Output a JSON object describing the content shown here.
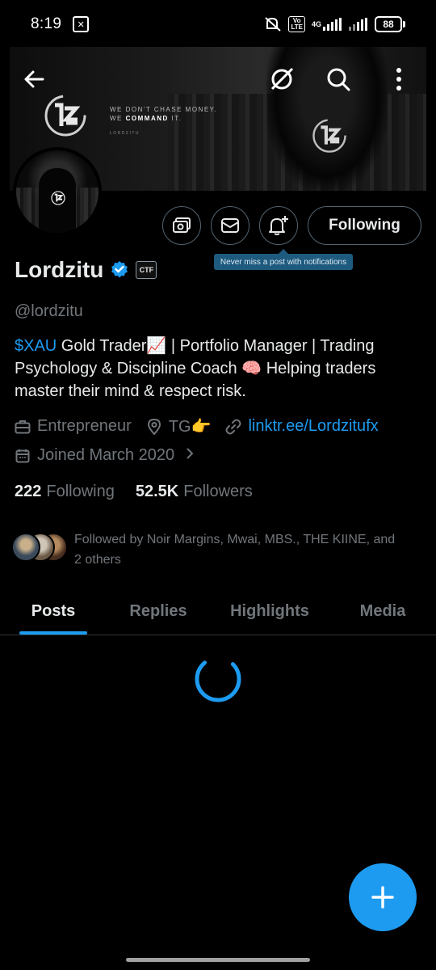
{
  "status_bar": {
    "time": "8:19",
    "signal_label": "4G",
    "volte_label": "Vo\nLTE",
    "battery": "88"
  },
  "banner": {
    "tagline_line1": "WE DON'T CHASE MONEY.",
    "tagline_line2_prefix": "WE ",
    "tagline_line2_bold": "COMMAND",
    "tagline_line2_suffix": " IT.",
    "sub": "LORDZITU"
  },
  "profile": {
    "name": "Lordzitu",
    "handle": "@lordzitu",
    "bio_cashtag": "$XAU",
    "bio_rest": " Gold Trader📈 | Portfolio Manager | Trading Psychology & Discipline Coach 🧠 Helping traders master their mind & respect risk.",
    "category": "Entrepreneur",
    "location": "TG👉",
    "link": "linktr.ee/Lordzitufx",
    "joined": "Joined March 2020",
    "following_count": "222",
    "following_label": "Following",
    "followers_count": "52.5K",
    "followers_label": "Followers",
    "followed_by": "Followed by Noir Margins, Mwai, MBS., THE KIINE, and 2 others",
    "affiliate_badge": "CTF"
  },
  "actions": {
    "following_button": "Following",
    "tooltip": "Never miss a post with notifications"
  },
  "tabs": [
    {
      "label": "Posts",
      "active": true
    },
    {
      "label": "Replies",
      "active": false
    },
    {
      "label": "Highlights",
      "active": false
    },
    {
      "label": "Media",
      "active": false
    }
  ],
  "colors": {
    "accent": "#1d9bf0",
    "muted": "#71767b",
    "background": "#000000",
    "text": "#e7e9ea"
  },
  "icons": {
    "back": "arrow-left-icon",
    "grok": "grok-icon",
    "search": "search-icon",
    "more": "more-vertical-icon",
    "tip": "tip-jar-icon",
    "message": "envelope-icon",
    "notify": "bell-plus-icon",
    "verified": "verified-badge-icon",
    "category": "briefcase-icon",
    "location": "location-pin-icon",
    "link": "link-icon",
    "calendar": "calendar-icon",
    "compose": "plus-icon"
  }
}
